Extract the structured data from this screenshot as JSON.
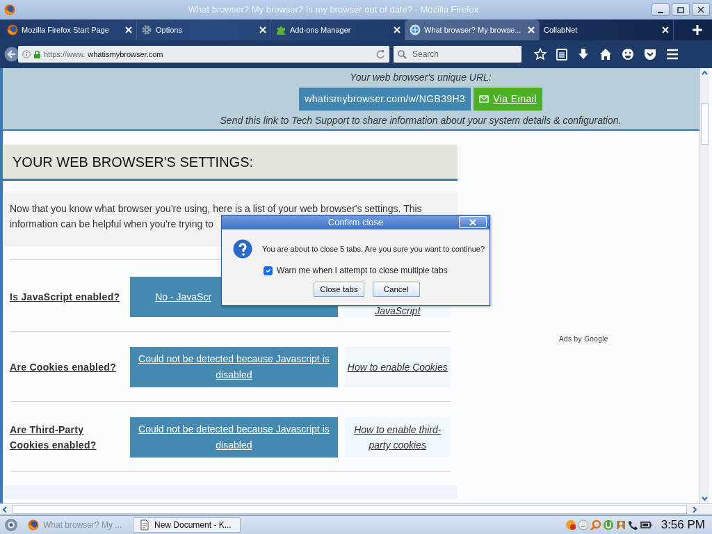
{
  "window": {
    "title": "What browser? My browser? Is my browser out of date? - Mozilla Firefox"
  },
  "tabs": [
    {
      "label": "Mozilla Firefox Start Page",
      "selected": false
    },
    {
      "label": "Options",
      "selected": false
    },
    {
      "label": "Add-ons Manager",
      "selected": false
    },
    {
      "label": "What browser? My browse...",
      "selected": true
    },
    {
      "label": "CollabNet",
      "selected": false
    }
  ],
  "address_bar": {
    "url_scheme": "https://www.",
    "url_host": "whatismybrowser.com"
  },
  "search": {
    "placeholder": "Search"
  },
  "page": {
    "unique_url_label": "Your web browser's unique URL:",
    "unique_url": "whatismybrowser.com/w/NGB39H3",
    "email_button": "Via Email",
    "share_note": "Send this link to Tech Support to share information about your system details & configuration.",
    "settings_heading": "YOUR WEB BROWSER'S SETTINGS:",
    "intro_lines": [
      "Now that you know what browser you're using, here is a list of your web browser's settings. This",
      "information can be helpful when you're trying to"
    ],
    "settings": [
      {
        "question": "Is JavaScript enabled?",
        "answer": "No - JavaScr",
        "help": "JavaScript"
      },
      {
        "question": "Are Cookies enabled?",
        "answer": "Could not be detected because Javascript is disabled",
        "help": "How to enable Cookies"
      },
      {
        "question": "Are Third-Party Cookies enabled?",
        "answer": "Could not be detected because Javascript is disabled",
        "help": "How to enable third-party cookies"
      }
    ],
    "ads_label": "Ads by Google"
  },
  "dialog": {
    "title": "Confirm close",
    "message": "You are about to close 5 tabs. Are you sure you want to continue?",
    "checkbox": {
      "label": "Warn me when I attempt to close multiple tabs",
      "checked": true
    },
    "buttons": [
      "Close tabs",
      "Cancel"
    ]
  },
  "taskbar": {
    "items": [
      {
        "label": "What browser? My ...",
        "dimmed": true
      },
      {
        "label": "New Document - K...",
        "dimmed": false
      }
    ],
    "clock": "3:56 PM"
  }
}
